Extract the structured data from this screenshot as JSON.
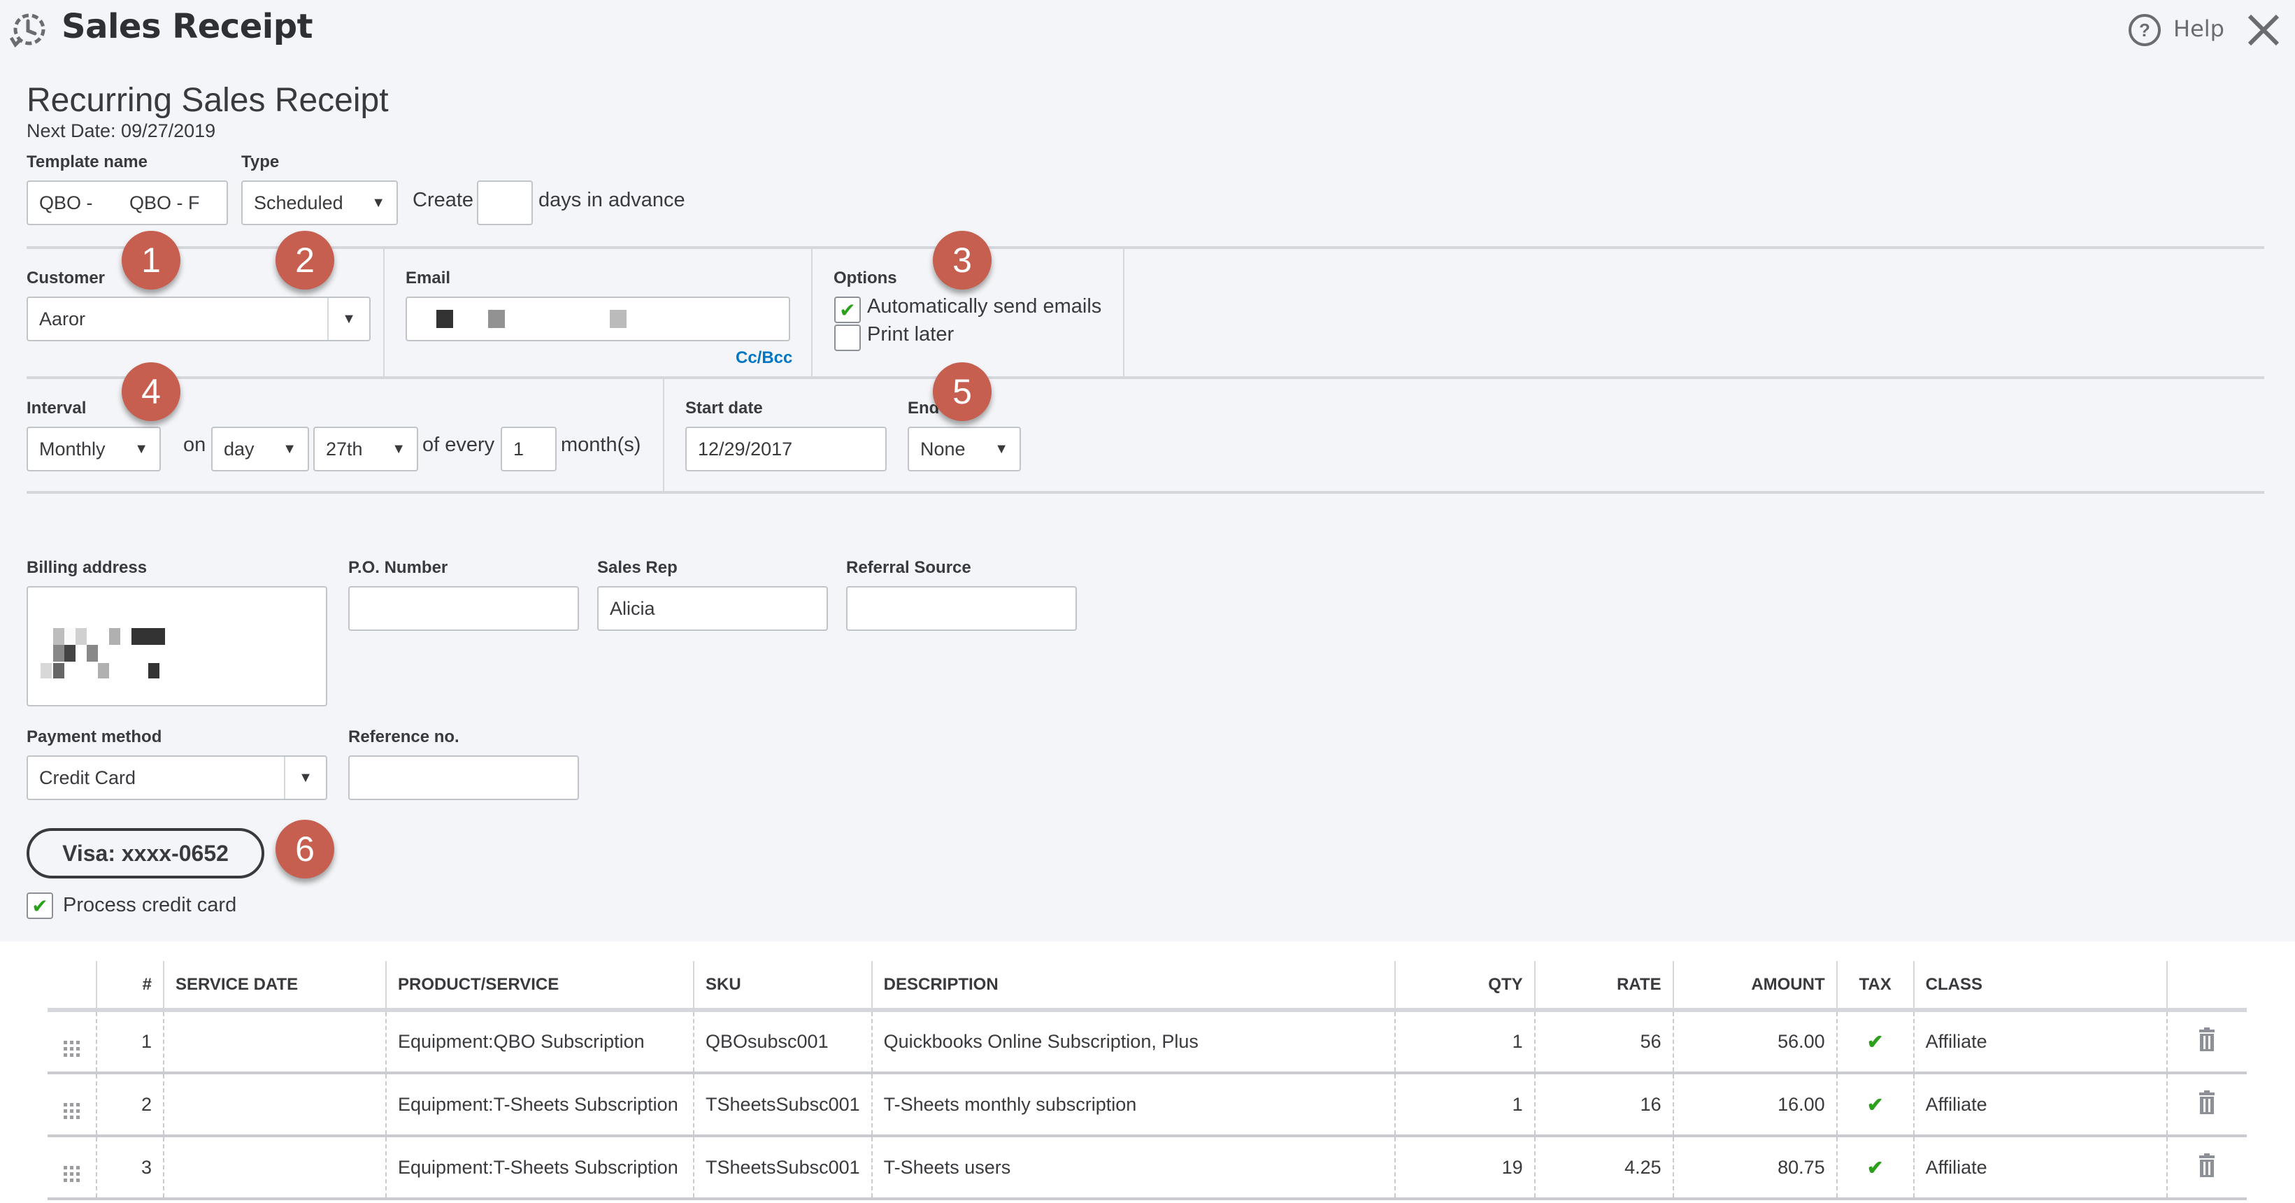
{
  "header": {
    "title": "Sales Receipt",
    "icon": "recurring-clock-icon",
    "help_label": "Help",
    "help_icon": "help-circle-icon",
    "close_icon": "close-icon"
  },
  "form": {
    "heading": "Recurring Sales Receipt",
    "next_date": "Next Date: 09/27/2019",
    "template_name": {
      "label": "Template name",
      "value": "QBO -       QBO - F"
    },
    "type": {
      "label": "Type",
      "value": "Scheduled"
    },
    "create": {
      "prefix": "Create",
      "value": "",
      "suffix": "days in advance"
    },
    "customer": {
      "label": "Customer",
      "value": "Aaror"
    },
    "email": {
      "label": "Email",
      "value": "",
      "cc_bcc": "Cc/Bcc"
    },
    "options": {
      "label": "Options",
      "auto_send": {
        "label": "Automatically send emails",
        "checked": true
      },
      "print_later": {
        "label": "Print later",
        "checked": false
      }
    },
    "interval": {
      "label": "Interval",
      "frequency": "Monthly",
      "on_label": "on",
      "day_type": "day",
      "day": "27th",
      "of_every_label": "of every",
      "every_value": "1",
      "unit_label": "month(s)"
    },
    "start_date": {
      "label": "Start date",
      "value": "12/29/2017"
    },
    "end": {
      "label": "End",
      "value": "None"
    },
    "billing_address": {
      "label": "Billing address"
    },
    "po_number": {
      "label": "P.O. Number",
      "value": ""
    },
    "sales_rep": {
      "label": "Sales Rep",
      "value": "Alicia"
    },
    "referral_source": {
      "label": "Referral Source",
      "value": ""
    },
    "payment_method": {
      "label": "Payment method",
      "value": "Credit Card"
    },
    "reference_no": {
      "label": "Reference no.",
      "value": ""
    },
    "card_button": "Visa: xxxx-0652",
    "process_card": {
      "label": "Process credit card",
      "checked": true
    }
  },
  "badges": [
    "1",
    "2",
    "3",
    "4",
    "5",
    "6"
  ],
  "badge_color": "#c65f50",
  "accent_colors": {
    "check": "#2ca01c",
    "link": "#0077c5"
  },
  "table": {
    "columns": [
      "",
      "#",
      "SERVICE DATE",
      "PRODUCT/SERVICE",
      "SKU",
      "DESCRIPTION",
      "QTY",
      "RATE",
      "AMOUNT",
      "TAX",
      "CLASS",
      ""
    ],
    "rows": [
      {
        "num": "1",
        "service_date": "",
        "product": "Equipment:QBO Subscription",
        "sku": "QBOsubsc001",
        "description": "Quickbooks Online Subscription, Plus",
        "qty": "1",
        "rate": "56",
        "amount": "56.00",
        "tax": true,
        "class": "Affiliate"
      },
      {
        "num": "2",
        "service_date": "",
        "product": "Equipment:T-Sheets Subscription",
        "sku": "TSheetsSubsc001",
        "description": "T-Sheets monthly subscription",
        "qty": "1",
        "rate": "16",
        "amount": "16.00",
        "tax": true,
        "class": "Affiliate"
      },
      {
        "num": "3",
        "service_date": "",
        "product": "Equipment:T-Sheets Subscription",
        "sku": "TSheetsSubsc001",
        "description": "T-Sheets users",
        "qty": "19",
        "rate": "4.25",
        "amount": "80.75",
        "tax": true,
        "class": "Affiliate"
      }
    ],
    "tax_icon": "checkmark-icon",
    "delete_icon": "trash-icon",
    "drag_icon": "drag-handle-icon"
  }
}
